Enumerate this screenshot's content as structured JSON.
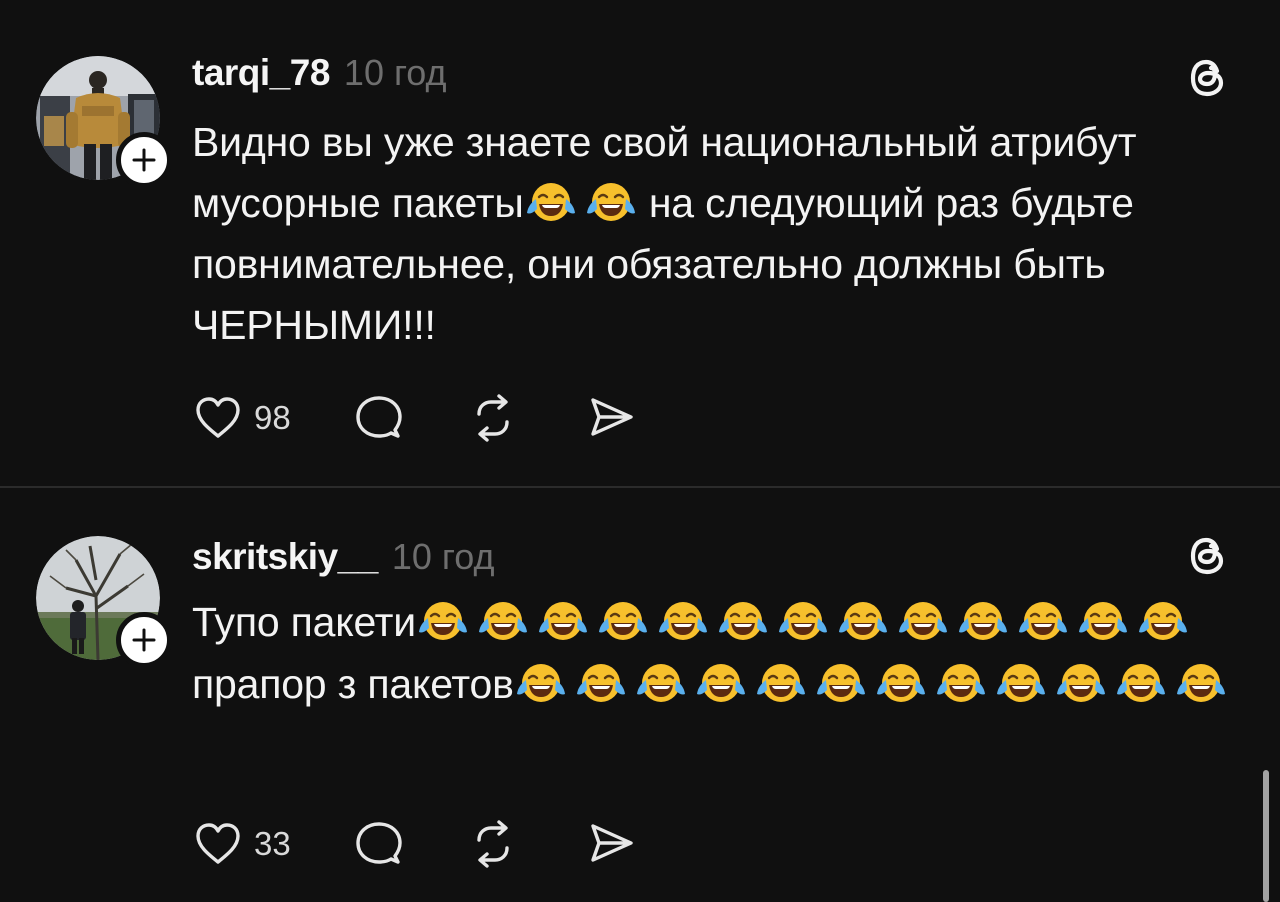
{
  "posts": [
    {
      "username": "tarqi_78",
      "timestamp": "10 год",
      "text_segments": [
        "Видно вы уже знаете свой национальный атрибут мусорные пакеты",
        "😂😂",
        " на следующий раз будьте повнимательнее, они обязательно должны быть ЧЕРНЫМИ!!!"
      ],
      "likes": "98",
      "icons": [
        "heart-icon",
        "comment-icon",
        "repost-icon",
        "share-icon",
        "threads-logo-icon",
        "plus-icon"
      ]
    },
    {
      "username": "skritskiy__",
      "timestamp": "10 год",
      "text_segments": [
        "Тупо пакети",
        "😂😂😂😂😂😂😂😂😂😂😂😂😂",
        " прапор з пакетов",
        "😂😂😂😂😂😂😂😂😂😂😂😂"
      ],
      "likes": "33",
      "icons": [
        "heart-icon",
        "comment-icon",
        "repost-icon",
        "share-icon",
        "threads-logo-icon",
        "plus-icon"
      ]
    }
  ],
  "colors": {
    "background": "#101010",
    "text": "#f3f3f3",
    "muted": "#6e6e6e",
    "divider": "#2b2b2b",
    "emoji": "#f7c02c"
  }
}
